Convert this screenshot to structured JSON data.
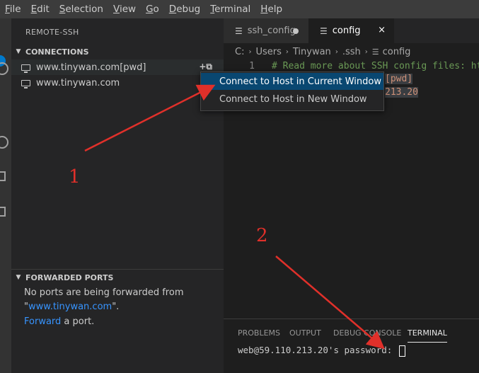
{
  "menubar": {
    "items": [
      {
        "key": "F",
        "rest": "ile"
      },
      {
        "key": "E",
        "rest": "dit"
      },
      {
        "key": "S",
        "rest": "election"
      },
      {
        "key": "V",
        "rest": "iew"
      },
      {
        "key": "G",
        "rest": "o"
      },
      {
        "key": "D",
        "rest": "ebug"
      },
      {
        "key": "T",
        "rest": "erminal"
      },
      {
        "key": "H",
        "rest": "elp"
      }
    ]
  },
  "sidebar": {
    "title": "REMOTE-SSH",
    "connections_header": "CONNECTIONS",
    "connections": [
      "www.tinywan.com[pwd]",
      "www.tinywan.com"
    ],
    "forwarded_header": "FORWARDED PORTS",
    "ports_message_1": "No ports are being forwarded from",
    "ports_quote_open": "\"",
    "ports_host": "www.tinywan.com",
    "ports_quote_close": "\".",
    "forward_link": "Forward",
    "forward_rest": " a port."
  },
  "tabs": [
    {
      "label": "ssh_config",
      "modified": true
    },
    {
      "label": "config",
      "active": true,
      "close": "×"
    }
  ],
  "breadcrumb": [
    "C:",
    "Users",
    "Tinywan",
    ".ssh",
    "config"
  ],
  "editor": {
    "line1_number": "1",
    "line1_comment": "# Read more about SSH config files: ht",
    "line2_fragment": "[pwd]",
    "line3_fragment": "213.20"
  },
  "context_menu": {
    "items": [
      "Connect to Host in Current Window",
      "Connect to Host in New Window"
    ]
  },
  "panel": {
    "tabs": [
      "PROBLEMS",
      "OUTPUT",
      "DEBUG CONSOLE",
      "TERMINAL"
    ],
    "terminal_line": "web@59.110.213.20's password: "
  },
  "annotations": {
    "label_1": "1",
    "label_2": "2",
    "color": "#e0302a"
  },
  "colors": {
    "accent": "#007acc",
    "menu_selected": "#094771",
    "link": "#3794ff"
  }
}
